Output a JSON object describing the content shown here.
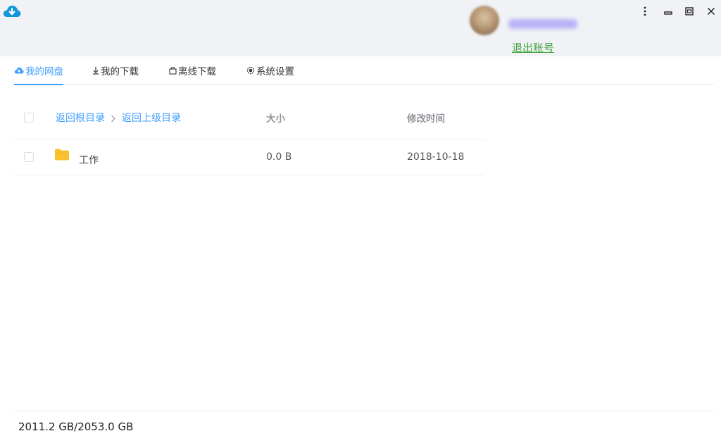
{
  "window": {
    "logo_icon": "cloud-download-icon",
    "brand_color": "#1296db",
    "controls": [
      "more-vertical-icon",
      "minimize-icon",
      "restore-icon",
      "close-icon"
    ]
  },
  "account": {
    "avatar_icon": "user-avatar",
    "logout_label": "退出账号",
    "link_color": "#3fa43b"
  },
  "tabs": [
    {
      "label": "我的网盘",
      "icon": "cloud-icon",
      "active": true
    },
    {
      "label": "我的下载",
      "icon": "download-arrow-icon",
      "active": false
    },
    {
      "label": "离线下载",
      "icon": "offline-bag-icon",
      "active": false
    },
    {
      "label": "系统设置",
      "icon": "gear-icon",
      "active": false
    }
  ],
  "accent_color": "#409eff",
  "file_table": {
    "breadcrumb": {
      "root_label": "返回根目录",
      "parent_label": "返回上级目录"
    },
    "columns": {
      "size": "大小",
      "modified": "修改时间"
    },
    "rows": [
      {
        "icon": "folder-icon",
        "name": "工作",
        "size": "0.0 B",
        "modified": "2018-10-18"
      }
    ]
  },
  "footer": {
    "storage_usage": "2011.2 GB/2053.0 GB"
  }
}
